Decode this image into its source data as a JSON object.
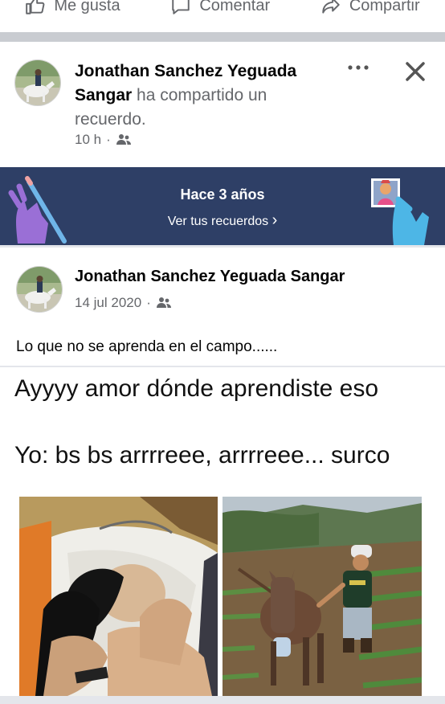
{
  "actions": {
    "like": "Me gusta",
    "comment": "Comentar",
    "share": "Compartir"
  },
  "share_card": {
    "author": "Jonathan Sanchez Yeguada Sangar",
    "action_text": "ha compartido un recuerdo.",
    "time": "10 h",
    "time_separator": "·",
    "audience_icon": "friends-icon",
    "more_icon": "more-dots-icon",
    "close_icon": "close-icon"
  },
  "memory_banner": {
    "title": "Hace 3 años",
    "link": "Ver tus recuerdos",
    "link_chevron": "›",
    "background": "#2e3f66"
  },
  "post": {
    "author": "Jonathan Sanchez Yeguada Sangar",
    "date": "14 jul 2020",
    "date_separator": "·",
    "text": "Lo que no se aprenda en el campo......",
    "meme_line_1": "Ayyyy amor dónde aprendiste eso",
    "meme_line_2": "Yo: bs bs arrrreee, arrrreee... surco"
  },
  "colors": {
    "secondary_text": "#65676b",
    "banner": "#2e3f66",
    "divider": "#c9ccd1"
  }
}
